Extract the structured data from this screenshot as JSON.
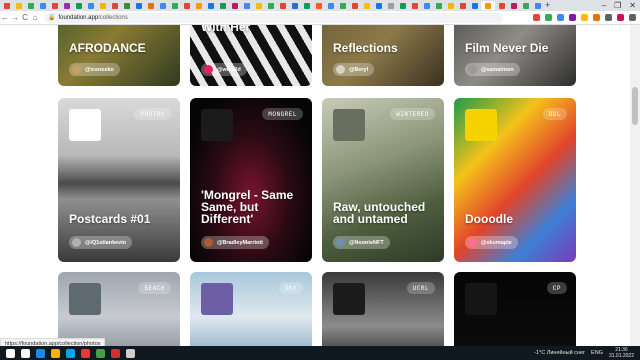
{
  "browser": {
    "tab_colors": [
      "#ea4335",
      "#fbbc04",
      "#34a853",
      "#4285f4",
      "#ea4335",
      "#9c27b0",
      "#0f9d58",
      "#4285f4",
      "#f4b400",
      "#db4437",
      "#3c8d2f",
      "#1a73e8",
      "#e37400",
      "#4285f4",
      "#34a853",
      "#ea4335",
      "#ff9800",
      "#1a73e8",
      "#0f9d58",
      "#c2185b",
      "#4285f4",
      "#fbbc04",
      "#34a853",
      "#ea4335",
      "#3367d6",
      "#0f9d58",
      "#ff5722",
      "#4285f4",
      "#34a853",
      "#ea4335",
      "#fbbc04",
      "#1a73e8",
      "#9e9e9e",
      "#0f9d58",
      "#ea4335",
      "#4285f4",
      "#34a853",
      "#f4b400",
      "#db4437",
      "#1a73e8",
      "#ff9800",
      "#ea4335",
      "#c2185b",
      "#34a853",
      "#4285f4"
    ],
    "new_tab_label": "+",
    "window_controls": [
      "–",
      "❐",
      "✕"
    ],
    "url_domain": "foundation.app",
    "url_path": "/collections",
    "nav": {
      "back": "←",
      "forward": "→",
      "reload": "C",
      "home": "⌂"
    },
    "extension_colors": [
      "#ea4335",
      "#34a853",
      "#4285f4",
      "#7b1fa2",
      "#fbbc04",
      "#e37400",
      "#5f6368",
      "#c2185b",
      "#5f6368"
    ]
  },
  "cards": [
    {
      "title": "AFRODANCE",
      "creator": "@icenesko",
      "tag": "",
      "bg": "linear-gradient(135deg,#3f5a2a,#8a7a35 45%,#2e3b1e)",
      "avatar_color": "#c9a064"
    },
    {
      "title": "Almost Moments With Her",
      "creator": "@wick3d",
      "tag": "",
      "bg": "repeating-linear-gradient(60deg,#111 0 9px,#e8e8e8 9px 16px)",
      "avatar_color": "#e91e63"
    },
    {
      "title": "Reflections",
      "creator": "@Beryl",
      "tag": "",
      "bg": "linear-gradient(135deg,#6d5b36,#8c7a4a 50%,#3a3020)",
      "avatar_color": "#d8d1c4"
    },
    {
      "title": "Film Never Die",
      "creator": "@samalmon",
      "tag": "",
      "bg": "linear-gradient(135deg,#4a4a48,#8e8c86 50%,#2d2d2c)",
      "avatar_color": "#9a9a9a"
    },
    {
      "title": "Postcards #01",
      "creator": "@iQ1stiankevin",
      "tag": "PHOTOS",
      "bg": "linear-gradient(180deg,#d9d9d9 0%,#b8b8b8 35%,#4b4b4b 52%,#8f8f8f 62%,#3a3a3a 100%)",
      "avatar_color": "#b0b0b0",
      "thumb": "#ffffff"
    },
    {
      "title": "'Mongrel - Same Same, but Different'",
      "creator": "@BradleyMarriott",
      "tag": "MONGREL",
      "bg": "radial-gradient(ellipse at 50% 60%,#7a1430 0%,#2a0a14 45%,#050505 80%)",
      "avatar_color": "#b35a2a",
      "thumb": "#1b1b1b"
    },
    {
      "title": "Raw, untouched and untamed",
      "creator": "@NoonieNFT",
      "tag": "WINTERED",
      "bg": "linear-gradient(160deg,#c8cbb9 0%,#8a9476 40%,#4d5e3e 70%,#2f3a28 100%)",
      "avatar_color": "#6e8fb0",
      "thumb": "#6a6e5e"
    },
    {
      "title": "Dooodle",
      "creator": "@skumapie",
      "tag": "DDL",
      "bg": "linear-gradient(135deg,#1e9b4a 0%,#f3c21a 30%,#e2452a 55%,#3d7fd6 78%,#7a3bb8 100%)",
      "avatar_color": "#ff6f91",
      "thumb": "#f5d200"
    },
    {
      "title": "",
      "creator": "",
      "tag": "BEACH",
      "bg": "linear-gradient(180deg,#9ea6ae 0%,#c7cbd0 50%,#7d868e 100%)",
      "avatar_color": "#ffffff",
      "thumb": "#5f6970"
    },
    {
      "title": "",
      "creator": "",
      "tag": "SKY",
      "bg": "linear-gradient(180deg,#a9c8dc 0%,#e0e8ee 50%,#7fa6c3 100%)",
      "avatar_color": "#ffffff",
      "thumb": "#6d5fa6"
    },
    {
      "title": "",
      "creator": "",
      "tag": "UCRL",
      "bg": "linear-gradient(180deg,#3a3a3a 0%,#8c8c8c 60%,#2a2a2a 100%)",
      "avatar_color": "#ffffff",
      "thumb": "#1c1c1c"
    },
    {
      "title": "",
      "creator": "",
      "tag": "CP",
      "bg": "linear-gradient(180deg,#050505 0%,#0d0d0d 100%)",
      "avatar_color": "#ffffff",
      "thumb": "#151515"
    }
  ],
  "status_bar_url": "https://foundation.app/collection/photos",
  "taskbar": {
    "icon_colors": [
      "#ffffff",
      "#f9f9f9",
      "#1e88e5",
      "#ffb300",
      "#00a4ef",
      "#e53935",
      "#43a047",
      "#d32f2f",
      "#cfcfcf"
    ],
    "weather": "-1°C Линейный снег",
    "lang": "ENG",
    "time": "21:36",
    "date": "31.01.2022"
  }
}
